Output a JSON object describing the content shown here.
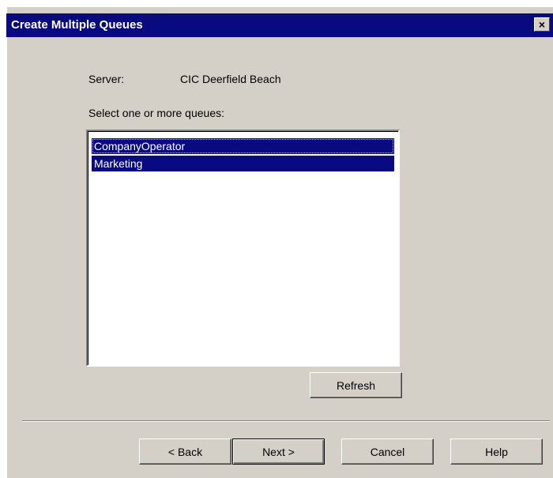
{
  "window": {
    "title": "Create Multiple Queues",
    "close_glyph": "×",
    "close_icon": "close-icon"
  },
  "server": {
    "label": "Server:",
    "value": "CIC Deerfield Beach"
  },
  "queues": {
    "prompt": "Select one or more queues:",
    "items": [
      {
        "label": "CompanyOperator",
        "selected": true
      },
      {
        "label": "Marketing",
        "selected": true
      }
    ]
  },
  "buttons": {
    "refresh": "Refresh",
    "back": "< Back",
    "next": "Next >",
    "cancel": "Cancel",
    "help": "Help"
  },
  "colors": {
    "dialog_bg": "#d4d0c8",
    "titlebar": "#0a0a80",
    "selection": "#0a0a80"
  }
}
